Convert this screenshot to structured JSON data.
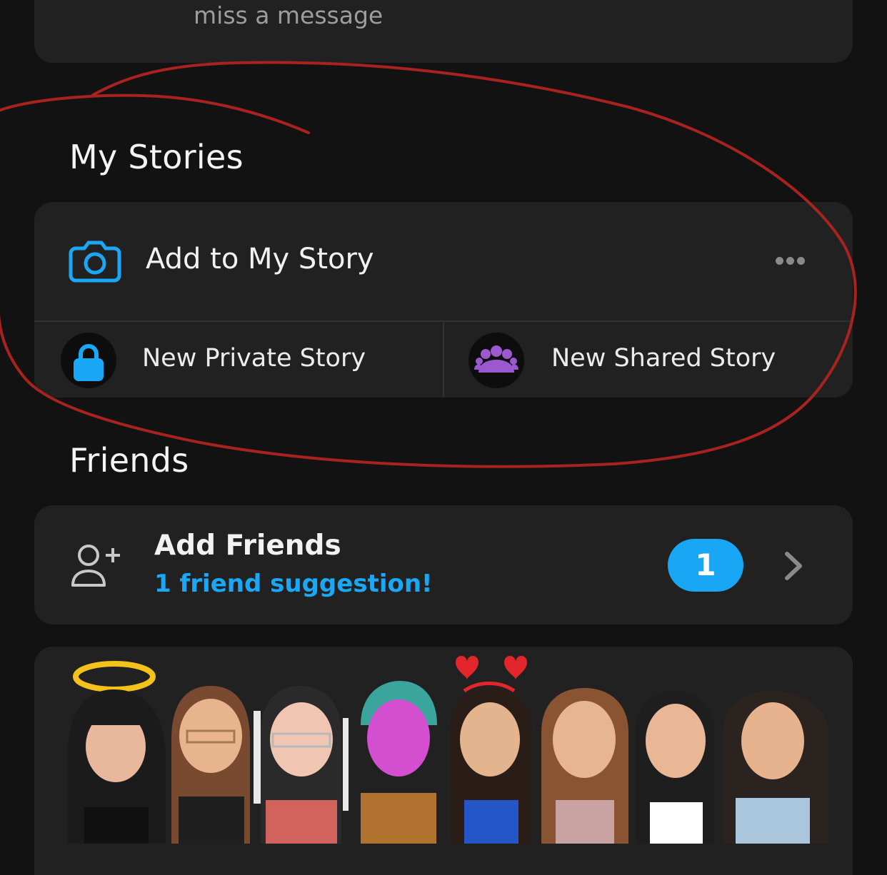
{
  "top_card": {
    "message_fragment": "miss a message"
  },
  "my_stories": {
    "title": "My Stories",
    "add_label": "Add to My Story",
    "private_label": "New Private Story",
    "shared_label": "New Shared Story",
    "icons": [
      "camera-icon",
      "more-icon",
      "lock-icon",
      "group-icon"
    ]
  },
  "friends": {
    "title": "Friends",
    "add_friends_label": "Add Friends",
    "suggestion_text": "1 friend suggestion!",
    "badge_count": "1",
    "icons": [
      "add-friend-icon",
      "chevron-right-icon"
    ]
  },
  "colors": {
    "background": "#121212",
    "card": "#212121",
    "accent_blue": "#1aa7f5",
    "lock_blue": "#1aa7f5",
    "group_purple": "#9b59d0",
    "annotation_red": "#a8231f"
  }
}
